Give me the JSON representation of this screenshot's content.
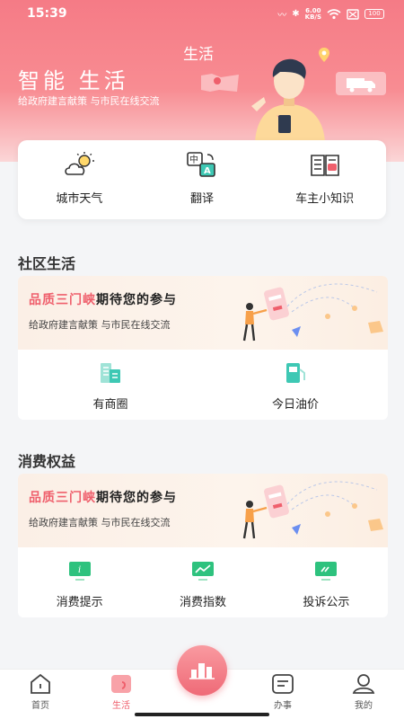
{
  "status": {
    "time": "15:39",
    "speed_value": "6.00",
    "speed_unit": "KB/S",
    "battery": "100"
  },
  "hero": {
    "title": "智能 生活",
    "subtitle": "给政府建言献策 与市民在线交流",
    "tag": "生活"
  },
  "quick": [
    {
      "label": "城市天气",
      "icon": "weather-icon"
    },
    {
      "label": "翻译",
      "icon": "translate-icon"
    },
    {
      "label": "车主小知识",
      "icon": "car-knowledge-icon"
    }
  ],
  "community": {
    "title": "社区生活",
    "banner": {
      "highlight": "品质三门峡",
      "rest": "期待您的参与",
      "subtitle": "给政府建言献策 与市民在线交流"
    },
    "items": [
      {
        "label": "有商圈",
        "icon": "business-district-icon"
      },
      {
        "label": "今日油价",
        "icon": "fuel-price-icon"
      }
    ]
  },
  "consumer": {
    "title": "消费权益",
    "banner": {
      "highlight": "品质三门峡",
      "rest": "期待您的参与",
      "subtitle": "给政府建言献策 与市民在线交流"
    },
    "items": [
      {
        "label": "消费提示",
        "icon": "consumption-tip-icon"
      },
      {
        "label": "消费指数",
        "icon": "consumption-index-icon"
      },
      {
        "label": "投诉公示",
        "icon": "complaint-notice-icon"
      }
    ]
  },
  "nav": {
    "home": "首页",
    "life": "生活",
    "affairs": "办事",
    "mine": "我的"
  },
  "colors": {
    "accent": "#ef5f6c",
    "teal": "#3ec8b4",
    "green": "#2ec27e"
  }
}
